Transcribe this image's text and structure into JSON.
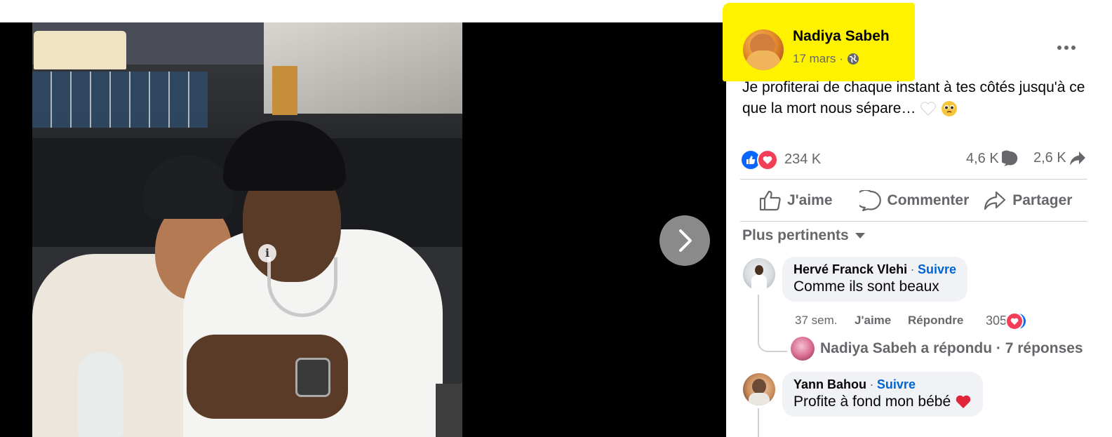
{
  "post": {
    "author": "Nadiya Sabeh",
    "date": "17 mars",
    "separator": "·",
    "privacy_icon": "globe-icon",
    "caption": "Je profiterai de chaque instant à tes côtés jusqu'à ce que la mort nous sépare…",
    "caption_emojis": [
      "white-heart",
      "pleading-face"
    ]
  },
  "stats": {
    "reactions": [
      "like",
      "love"
    ],
    "reaction_count": "234 K",
    "comments": "4,6 K",
    "shares": "2,6 K"
  },
  "actions": {
    "like": "J'aime",
    "comment": "Commenter",
    "share": "Partager"
  },
  "sort_label": "Plus pertinents",
  "comments": [
    {
      "name": "Hervé Franck Vlehi",
      "follow": "Suivre",
      "text": "Comme ils sont beaux",
      "time": "37 sem.",
      "like": "J'aime",
      "reply": "Répondre",
      "reaction_count": "305",
      "replies_summary": "Nadiya Sabeh a répondu · 7 réponses"
    },
    {
      "name": "Yann Bahou",
      "follow": "Suivre",
      "text": "Profite à fond mon bébé"
    }
  ],
  "colors": {
    "highlight": "#fff200",
    "facebook_blue": "#0866ff",
    "love_red": "#f33e58",
    "muted_text": "#65676b",
    "follow_blue": "#0064d1"
  }
}
